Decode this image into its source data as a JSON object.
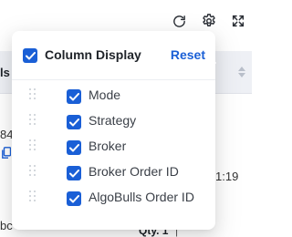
{
  "toolbar": {
    "icons": [
      "reload-icon",
      "settings-icon",
      "fullscreen-icon"
    ]
  },
  "background": {
    "header_fragment": "ls",
    "cell_fragments": [
      "84",
      "bc"
    ],
    "time_fragment": "1:19",
    "qty_label": "Qty. 1",
    "qty_separator": "|"
  },
  "column_display": {
    "title": "Column Display",
    "reset_label": "Reset",
    "all_checked": true,
    "items": [
      {
        "label": "Mode",
        "checked": true
      },
      {
        "label": "Strategy",
        "checked": true
      },
      {
        "label": "Broker",
        "checked": true
      },
      {
        "label": "Broker Order ID",
        "checked": true
      },
      {
        "label": "AlgoBulls Order ID",
        "checked": true
      }
    ]
  },
  "colors": {
    "accent": "#1a5fd6",
    "header_bg": "#eef0f5",
    "text": "#1f2329"
  }
}
